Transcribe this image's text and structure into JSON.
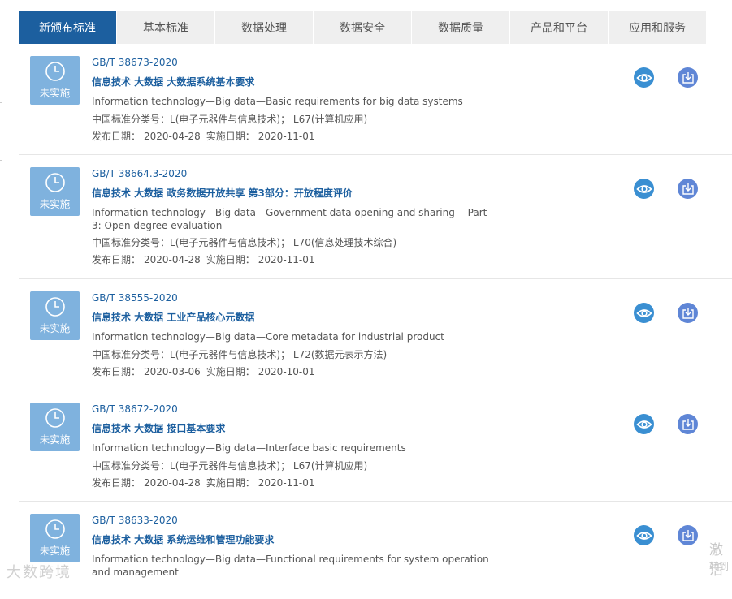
{
  "tabs": [
    {
      "label": "新颁布标准",
      "active": true
    },
    {
      "label": "基本标准",
      "active": false
    },
    {
      "label": "数据处理",
      "active": false
    },
    {
      "label": "数据安全",
      "active": false
    },
    {
      "label": "数据质量",
      "active": false
    },
    {
      "label": "产品和平台",
      "active": false
    },
    {
      "label": "应用和服务",
      "active": false
    }
  ],
  "labels": {
    "classification": "中国标准分类号：",
    "publish_date": "发布日期：",
    "implement_date": "实施日期："
  },
  "standards": [
    {
      "status": "未实施",
      "code": "GB/T 38673-2020",
      "title": "信息技术 大数据 大数据系统基本要求",
      "title_en": "Information technology—Big data—Basic requirements for big data systems",
      "classification": "L(电子元器件与信息技术)； L67(计算机应用)",
      "publish_date": "2020-04-28",
      "implement_date": "2020-11-01"
    },
    {
      "status": "未实施",
      "code": "GB/T 38664.3-2020",
      "title": "信息技术 大数据 政务数据开放共享 第3部分：开放程度评价",
      "title_en": "Information technology—Big data—Government data opening and sharing— Part 3: Open degree evaluation",
      "classification": "L(电子元器件与信息技术)； L70(信息处理技术综合)",
      "publish_date": "2020-04-28",
      "implement_date": "2020-11-01"
    },
    {
      "status": "未实施",
      "code": "GB/T 38555-2020",
      "title": "信息技术 大数据 工业产品核心元数据",
      "title_en": "Information technology—Big data—Core metadata for industrial product",
      "classification": "L(电子元器件与信息技术)； L72(数据元表示方法)",
      "publish_date": "2020-03-06",
      "implement_date": "2020-10-01"
    },
    {
      "status": "未实施",
      "code": "GB/T 38672-2020",
      "title": "信息技术 大数据 接口基本要求",
      "title_en": "Information technology—Big data—Interface basic requirements",
      "classification": "L(电子元器件与信息技术)； L67(计算机应用)",
      "publish_date": "2020-04-28",
      "implement_date": "2020-11-01"
    },
    {
      "status": "未实施",
      "code": "GB/T 38633-2020",
      "title": "信息技术 大数据 系统运维和管理功能要求",
      "title_en": "Information technology—Big data—Functional requirements for system operation and management",
      "classification": "",
      "publish_date": "",
      "implement_date": ""
    }
  ],
  "watermark": "大数跨境",
  "side_overlay": {
    "line1": "激活",
    "line2": "转到"
  },
  "colors": {
    "accent": "#1c5f9f",
    "status_bg": "#7fb2de",
    "view_btn": "#3a8fd2",
    "download_btn": "#5f86d6"
  },
  "icons": {
    "status": "clock-icon",
    "view": "eye-icon",
    "download": "download-icon"
  }
}
